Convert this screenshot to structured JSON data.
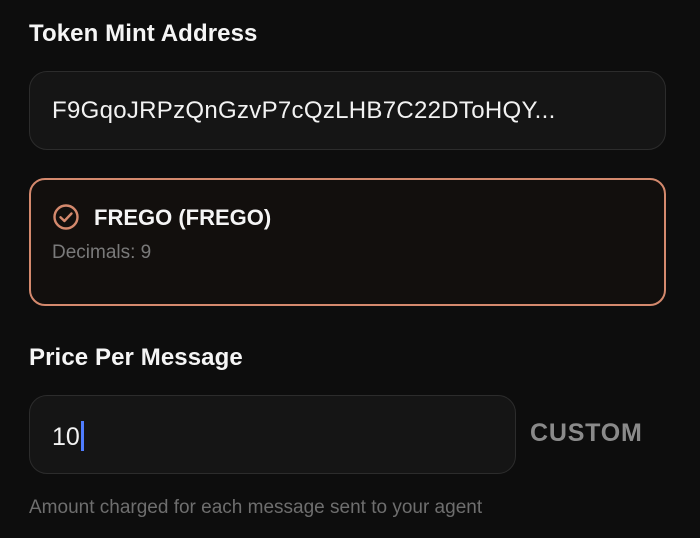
{
  "mint": {
    "label": "Token Mint Address",
    "value": "F9GqoJRPzQnGzvP7cQzLHB7C22DToHQY..."
  },
  "token": {
    "name": "FREGO (FREGO)",
    "decimals_text": "Decimals: 9",
    "status_icon": "check-circle-icon",
    "accent_color": "#d4896d"
  },
  "price": {
    "label": "Price Per Message",
    "value": "10",
    "custom_label": "CUSTOM",
    "helper": "Amount charged for each message sent to your agent"
  }
}
